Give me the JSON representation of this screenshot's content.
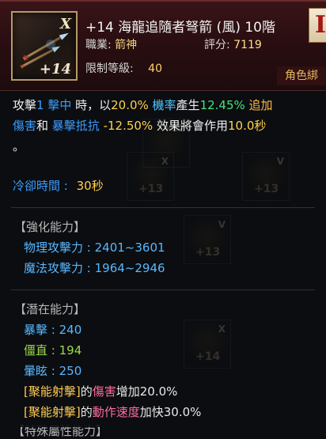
{
  "colors": {
    "accent_gold": "#f0d27a",
    "blue": "#3d9cff",
    "green": "#48e07a",
    "yellow": "#ffd24a",
    "pink": "#ff7db0",
    "header_bg": "#2a0e11"
  },
  "header": {
    "icon_mark": "X",
    "icon_upgrade": "+14",
    "title": "+14 海龍追隨者弩箭 (風) 10階",
    "job_label": "職業",
    "job_value": "箭神",
    "score_label": "評分",
    "score_value": "7119",
    "level_label": "限制等級",
    "level_value": "40",
    "grade_letter": "I",
    "role_tag": "角色綁"
  },
  "effect": {
    "line1": {
      "a": "攻擊",
      "b": "1 擊中",
      "c": " 時，以",
      "d": "20.0%",
      "e": " 機率",
      "f": "產生",
      "g": "12.45%",
      "h": " 追加"
    },
    "line2": {
      "a": "傷害",
      "b": "和",
      "c": " 暴擊抵抗",
      "d": " -12.50%",
      "e": " 效果將會作用",
      "f": "10.0秒"
    },
    "line3": "。",
    "cooldown_label": "冷卻時間 :",
    "cooldown_value": "30秒"
  },
  "enhance": {
    "title": "【強化能力】",
    "items": [
      {
        "label": "物理攻擊力",
        "value": "2401~3601"
      },
      {
        "label": "魔法攻擊力",
        "value": "1964~2946"
      }
    ]
  },
  "potential": {
    "title": "【潛在能力】",
    "items": [
      {
        "label": "暴擊",
        "value": "240"
      },
      {
        "label": "僵直",
        "value": "194"
      },
      {
        "label": "暈眩",
        "value": "250"
      }
    ]
  },
  "skills": [
    {
      "bracket": "[聚能射擊]",
      "mid": "的",
      "hl": "傷害",
      "rest": "增加20.0%"
    },
    {
      "bracket": "[聚能射擊]",
      "mid": "的",
      "hl": "動作速度",
      "rest": "加快30.0%"
    }
  ],
  "cut_off_line": "【特殊屬性能力】"
}
